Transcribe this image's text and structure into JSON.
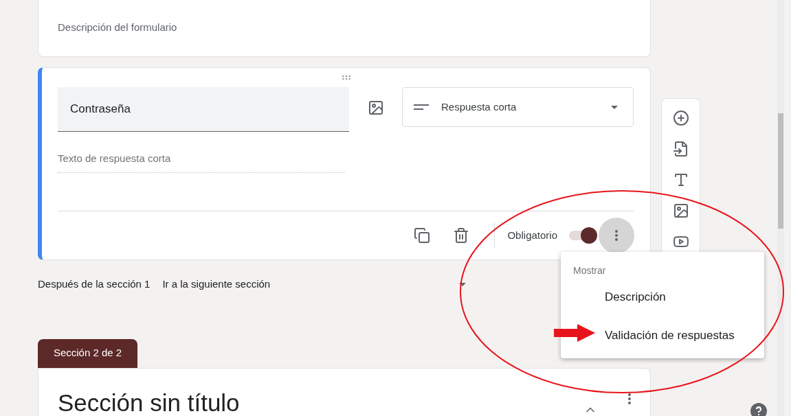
{
  "form_description": {
    "placeholder": "Descripción del formulario"
  },
  "question": {
    "title": "Contraseña",
    "type": "Respuesta corta",
    "answer_placeholder": "Texto de respuesta corta",
    "required": {
      "label": "Obligatorio",
      "on": true
    },
    "menu_open": true
  },
  "after_section": {
    "label": "Después de la sección 1",
    "value": "Ir a la siguiente sección"
  },
  "section": {
    "tab": "Sección 2 de 2",
    "title": "Sección sin título"
  },
  "menu": {
    "heading": "Mostrar",
    "items": [
      {
        "label": "Descripción",
        "pointed": false
      },
      {
        "label": "Validación de respuestas",
        "pointed": true
      }
    ]
  }
}
